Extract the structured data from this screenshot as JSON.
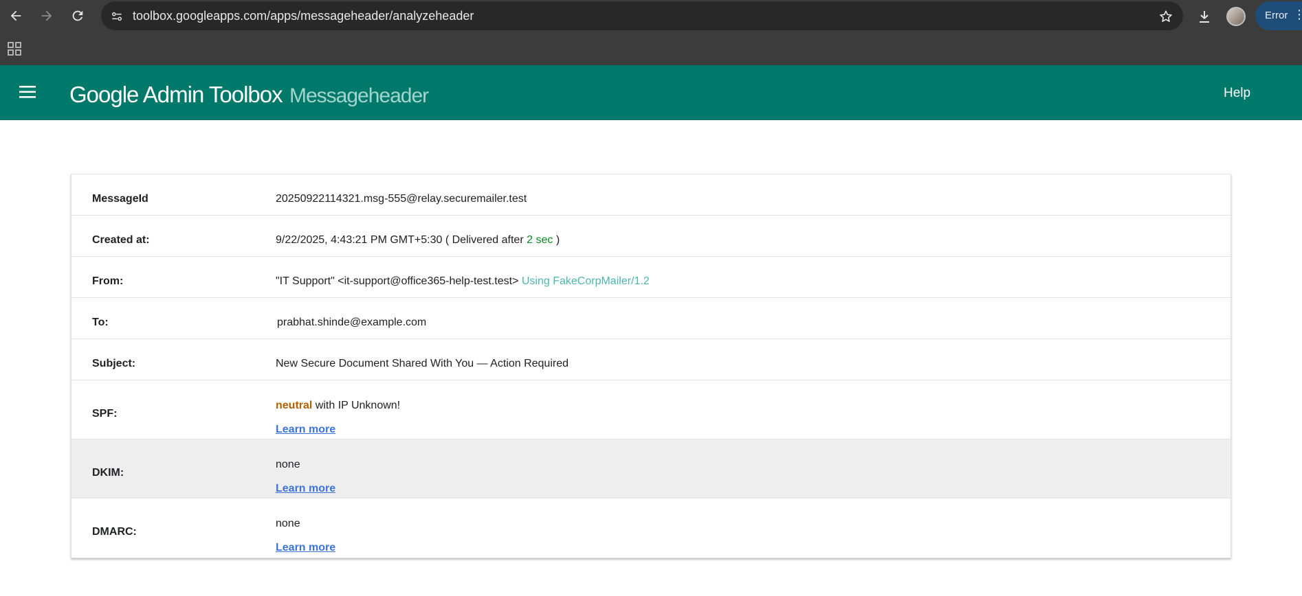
{
  "browser": {
    "url": "toolbox.googleapps.com/apps/messageheader/analyzeheader",
    "profile_status": "Error"
  },
  "header": {
    "brand": "Google Admin Toolbox",
    "product": "Messageheader",
    "help_label": "Help"
  },
  "colors": {
    "header_bg": "#00796b",
    "delivery_time": "#0a8a1f",
    "mailer": "#4db6ac",
    "spf_result": "#b35f00",
    "link": "#3b74d6"
  },
  "rows": {
    "message_id": {
      "label": "MessageId",
      "value": "20250922114321.msg-555@relay.securemailer.test"
    },
    "created_at": {
      "label": "Created at:",
      "value": "9/22/2025, 4:43:21 PM GMT+5:30",
      "delivered_prefix": "( Delivered after",
      "delivered_time": "2 sec",
      "delivered_suffix": ")"
    },
    "from": {
      "label": "From:",
      "value": "\"IT Support\" <it-support@office365-help-test.test>",
      "mailer": "Using FakeCorpMailer/1.2"
    },
    "to": {
      "label": "To:",
      "value": "prabhat.shinde@example.com"
    },
    "subject": {
      "label": "Subject:",
      "value": "New Secure Document Shared With You — Action Required"
    },
    "spf": {
      "label": "SPF:",
      "result": "neutral",
      "detail": "with IP Unknown!",
      "link": "Learn more"
    },
    "dkim": {
      "label": "DKIM:",
      "value": "none",
      "link": "Learn more"
    },
    "dmarc": {
      "label": "DMARC:",
      "value": "none",
      "link": "Learn more"
    }
  }
}
